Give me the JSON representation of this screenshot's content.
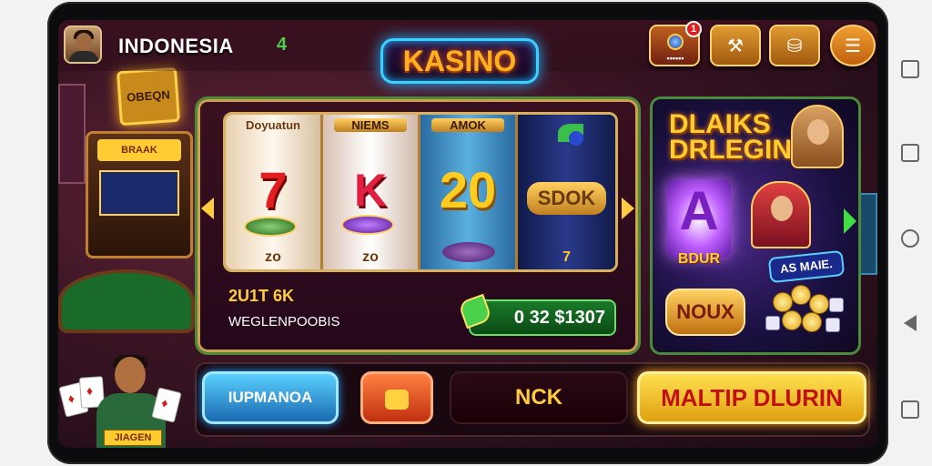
{
  "header": {
    "country": "INDONESIA",
    "level": "4",
    "logo": "KASINO",
    "notification_count": "1",
    "bag_caption": "••••••"
  },
  "background": {
    "sign": "OBEQN",
    "arcade_topper": "BRAAK"
  },
  "slot": {
    "reels": [
      {
        "top": "Doyuatun",
        "middle": "7",
        "bottom": "zo"
      },
      {
        "top": "NIEMS",
        "middle": "K",
        "bottom": "zo"
      },
      {
        "top": "AMOK",
        "middle": "20",
        "bottom": ""
      },
      {
        "top": "",
        "middle": "SDOK",
        "bottom": "7"
      }
    ],
    "win_label": "2U1T 6K",
    "win_sub": "WEGLENPOOBIS",
    "credit": "0 32 $1307"
  },
  "promo": {
    "title": "DLAIKS DRLEGIN",
    "big_letter": "A",
    "big_letter_caption": "BDUR",
    "tag": "AS MAIE.",
    "badge": "NOUX"
  },
  "controls": {
    "blue_button": "IUPMANOA",
    "ticket_button": "",
    "dark_button": "NCK",
    "gold_button": "MALTIP DLURIN"
  },
  "dealer": {
    "plate": "JIAGEN"
  },
  "colors": {
    "accent_gold": "#ffcc30",
    "frame_green": "#4a8a3a",
    "logo_glow": "#20b0ff",
    "credit_green": "#1a7a2a"
  },
  "icons": [
    "avatar",
    "globe-bag-icon",
    "tools-icon",
    "shop-icon",
    "menu-icon",
    "ticket-icon",
    "money-icon"
  ]
}
